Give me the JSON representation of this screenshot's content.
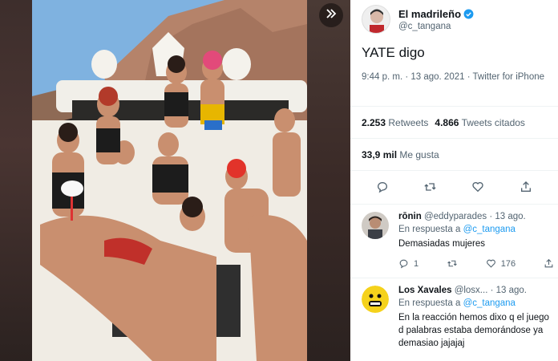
{
  "viewer": {
    "expand_icon": "double-chevron-right-icon"
  },
  "tweet": {
    "author_name": "El madrileño",
    "author_handle": "@c_tangana",
    "text": "YATE digo",
    "time": "9:44 p. m. · 13 ago. 2021 · Twitter for iPhone",
    "retweets_count": "2.253",
    "retweets_label": "Retweets",
    "quotes_count": "4.866",
    "quotes_label": "Tweets citados",
    "likes_count": "33,9 mil",
    "likes_label": "Me gusta",
    "verified_color": "#1d9bf0"
  },
  "replies": [
    {
      "name": "rōnin",
      "handle": "@eddyparades",
      "date": "· 13 ago.",
      "reply_prefix": "En respuesta a",
      "reply_to": "@c_tangana",
      "text": "Demasiadas mujeres",
      "reply_count": "1",
      "like_count": "176"
    },
    {
      "name": "Los Xavales",
      "handle": "@losx...",
      "date": "· 13 ago.",
      "reply_prefix": "En respuesta a",
      "reply_to": "@c_tangana",
      "text": "En la reacción hemos dixo q el juego d palabras estaba demorándose ya demasiao jajajaj"
    }
  ],
  "colors": {
    "accent": "#1d9bf0",
    "secondary_text": "#536471"
  }
}
